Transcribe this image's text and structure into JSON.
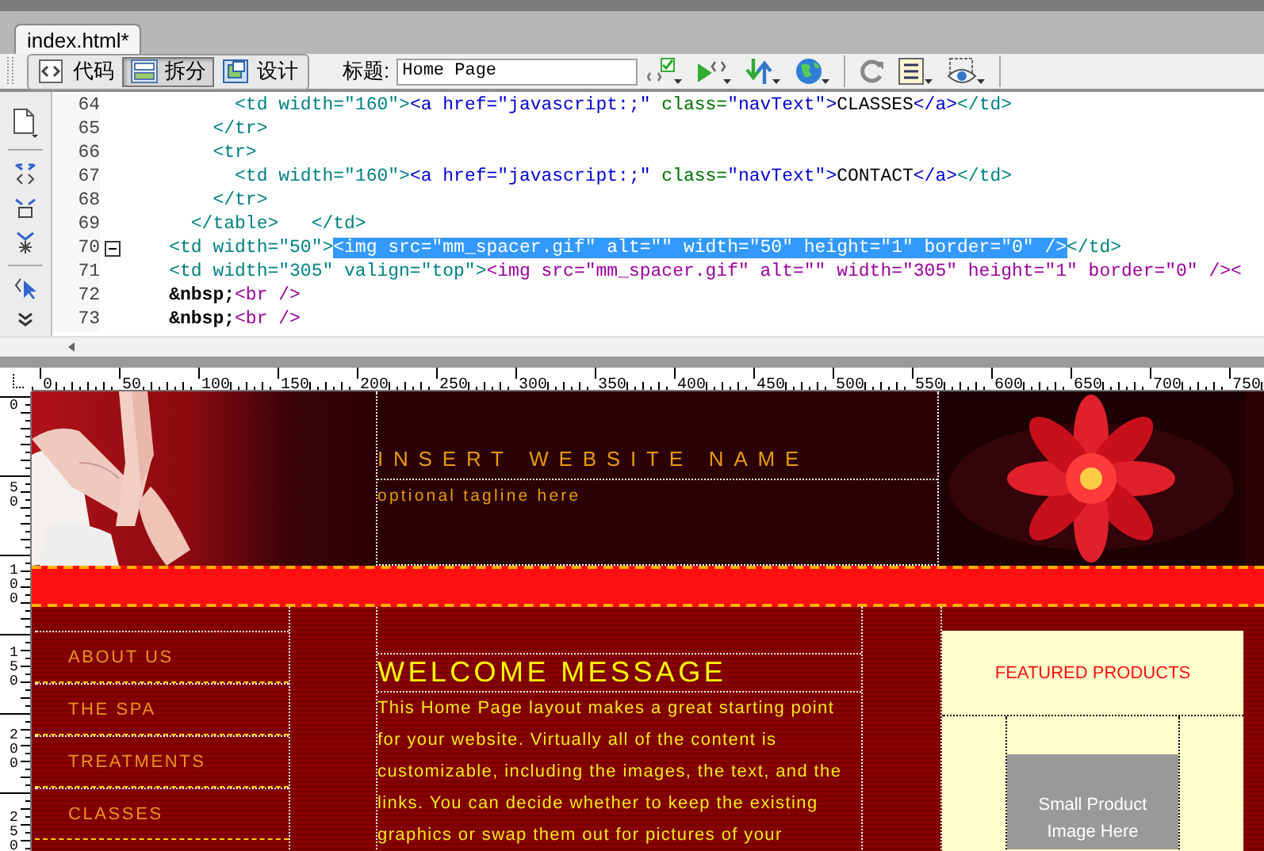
{
  "tabs": [
    {
      "label": "index.html*",
      "selected": true
    }
  ],
  "toolbar": {
    "view_buttons": [
      {
        "label": "代码",
        "selected": false
      },
      {
        "label": "拆分",
        "selected": true
      },
      {
        "label": "设计",
        "selected": false
      }
    ],
    "title_label": "标题:",
    "title_field": {
      "value": "Home Page"
    }
  },
  "code": {
    "lines": [
      {
        "number": "64",
        "collapsible": false,
        "segments": [
          {
            "kind": "td",
            "text": "          <td width=\"160\">"
          },
          {
            "kind": "a",
            "text": "<a href=\"javascript:;\""
          },
          {
            "kind": "attr",
            "text": " class="
          },
          {
            "kind": "a",
            "text": "\"navText\">"
          },
          {
            "kind": "text",
            "text": "CLASSES"
          },
          {
            "kind": "a",
            "text": "</a>"
          },
          {
            "kind": "td",
            "text": "</td>"
          }
        ]
      },
      {
        "number": "65",
        "collapsible": false,
        "segments": [
          {
            "kind": "td",
            "text": "        </tr>"
          }
        ]
      },
      {
        "number": "66",
        "collapsible": false,
        "segments": [
          {
            "kind": "td",
            "text": "        <tr>"
          }
        ]
      },
      {
        "number": "67",
        "collapsible": false,
        "segments": [
          {
            "kind": "td",
            "text": "          <td width=\"160\">"
          },
          {
            "kind": "a",
            "text": "<a href=\"javascript:;\""
          },
          {
            "kind": "attr",
            "text": " class="
          },
          {
            "kind": "a",
            "text": "\"navText\">"
          },
          {
            "kind": "text",
            "text": "CONTACT"
          },
          {
            "kind": "a",
            "text": "</a>"
          },
          {
            "kind": "td",
            "text": "</td>"
          }
        ]
      },
      {
        "number": "68",
        "collapsible": false,
        "segments": [
          {
            "kind": "td",
            "text": "        </tr>"
          }
        ]
      },
      {
        "number": "69",
        "collapsible": false,
        "segments": [
          {
            "kind": "td",
            "text": "      </table>   </td>"
          }
        ]
      },
      {
        "number": "70",
        "collapsible": true,
        "segments": [
          {
            "kind": "td",
            "text": "    <td width=\"50\">"
          },
          {
            "kind": "selection",
            "text": "<img src=\"mm_spacer.gif\" alt=\"\" width=\"50\" height=\"1\" border=\"0\" />"
          },
          {
            "kind": "td",
            "text": "</td>"
          }
        ]
      },
      {
        "number": "71",
        "collapsible": false,
        "segments": [
          {
            "kind": "td",
            "text": "    <td width=\"305\" valign=\"top\">"
          },
          {
            "kind": "img",
            "text": "<img src=\"mm_spacer.gif\" alt=\"\" width=\"305\" height=\"1\" border=\"0\" /><"
          }
        ]
      },
      {
        "number": "72",
        "collapsible": false,
        "segments": [
          {
            "kind": "entity",
            "text": "    &nbsp;"
          },
          {
            "kind": "img",
            "text": "<br />"
          }
        ]
      },
      {
        "number": "73",
        "collapsible": false,
        "segments": [
          {
            "kind": "entity",
            "text": "    &nbsp;"
          },
          {
            "kind": "img",
            "text": "<br />"
          }
        ]
      }
    ]
  },
  "ruler": {
    "horizontal": [
      "0",
      "50",
      "100",
      "150",
      "200",
      "250",
      "300",
      "350",
      "400",
      "450",
      "500",
      "550",
      "600",
      "650",
      "700",
      "750"
    ],
    "vertical": [
      "0",
      "50",
      "100",
      "150",
      "200",
      "250"
    ]
  },
  "design": {
    "site_name": "INSERT WEBSITE NAME",
    "tagline": "optional tagline here",
    "nav": [
      "ABOUT US",
      "THE SPA",
      "TREATMENTS",
      "CLASSES"
    ],
    "welcome": {
      "heading": "WELCOME MESSAGE",
      "body": "This Home Page layout makes a great starting point for your website. Virtually all of the content is customizable, including the images, the text, and the links. You can decide whether to keep the existing graphics or swap them out for pictures of your"
    },
    "featured": {
      "heading": "FEATURED PRODUCTS",
      "image_label": "Small Product Image Here"
    }
  }
}
